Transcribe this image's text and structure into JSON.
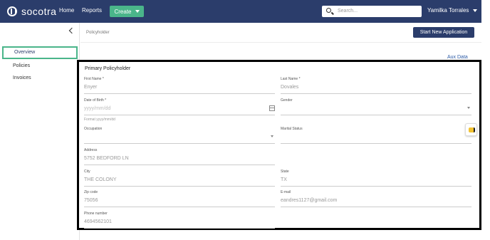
{
  "header": {
    "logo_text": "socotra",
    "nav": [
      "Home",
      "Reports"
    ],
    "create_label": "Create",
    "search_placeholder": "Search...",
    "user_name": "Yamilka Torrales"
  },
  "sidebar": {
    "items": [
      {
        "label": "Overview",
        "active": true
      },
      {
        "label": "Policies",
        "active": false
      },
      {
        "label": "Invoices",
        "active": false
      }
    ]
  },
  "breadcrumb": "Policyholder",
  "actions": {
    "start_new_application": "Start New Application",
    "aux_data": "Aux Data"
  },
  "form": {
    "title": "Primary Policyholder",
    "first_name": {
      "label": "First Name *",
      "value": "Enyer"
    },
    "last_name": {
      "label": "Last Name *",
      "value": "Dovales"
    },
    "dob": {
      "label": "Date of Birth *",
      "placeholder": "yyyy/mm/dd",
      "hint": "Format yyyy/mm/dd"
    },
    "gender": {
      "label": "Gender",
      "value": ""
    },
    "occupation": {
      "label": "Occupation",
      "value": ""
    },
    "marital_status": {
      "label": "Marital Status",
      "value": ""
    },
    "address": {
      "label": "Address",
      "value": "5752 BEDFORD LN"
    },
    "city": {
      "label": "City",
      "value": "THE COLONY"
    },
    "state": {
      "label": "State",
      "value": "TX"
    },
    "zip": {
      "label": "Zip code",
      "value": "75056"
    },
    "email": {
      "label": "E-mail",
      "value": "eandres1127@gmail.com"
    },
    "phone": {
      "label": "Phone number",
      "value": "4694562101"
    }
  },
  "colors": {
    "nav_bg": "#2b3d6b",
    "accent_green": "#4ab58a",
    "highlight_border": "#000000"
  }
}
